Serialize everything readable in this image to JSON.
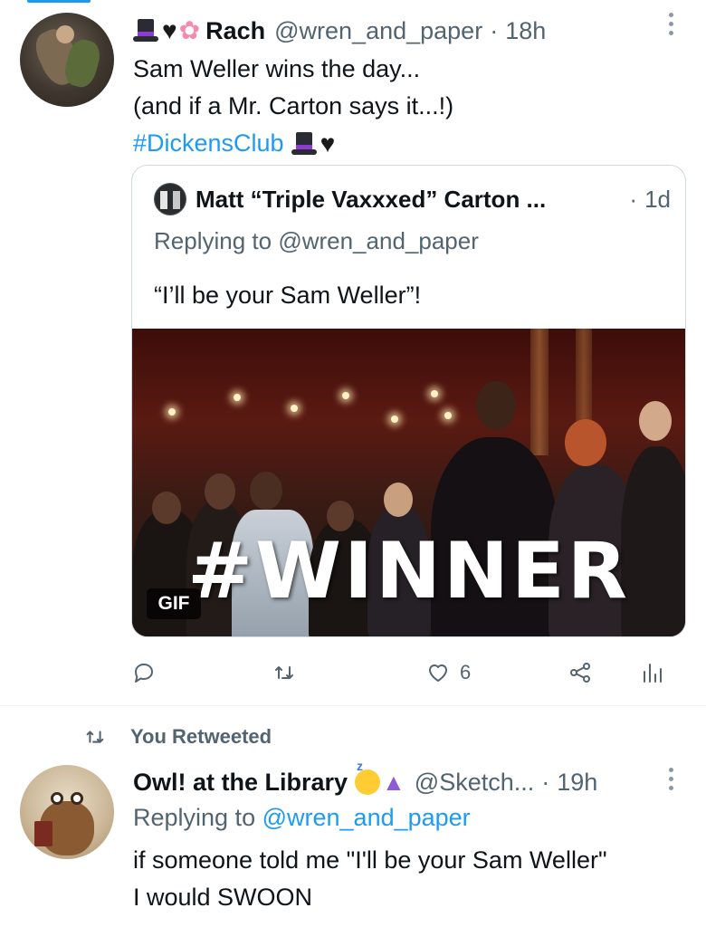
{
  "tweet1": {
    "author_name": "Rach",
    "handle": "@wren_and_paper",
    "separator": "·",
    "time": "18h",
    "name_emojis": [
      "top-hat-icon",
      "black-heart-icon",
      "cherry-blossom-icon"
    ],
    "text_lines": [
      "Sam Weller wins the day...",
      "(and if a Mr. Carton says it...!)"
    ],
    "hashtag": "#DickensClub",
    "quoted": {
      "author_name": "Matt “Triple Vaxxxed” Carton ...",
      "separator": "·",
      "time": "1d",
      "reply_prefix": "Replying to",
      "reply_handle": "@wren_and_paper",
      "text": "“I’ll be your Sam Weller”!",
      "gif_caption": "#WINNER",
      "gif_badge": "GIF"
    },
    "actions": {
      "reply_count": "",
      "retweet_count": "",
      "like_count": "6"
    }
  },
  "retweet_banner": "You Retweeted",
  "tweet2": {
    "author_name": "Owl! at the Library",
    "handle": "@Sketch...",
    "separator": "·",
    "time": "19h",
    "name_emojis": [
      "sleeping-face-icon",
      "mage-icon"
    ],
    "reply_prefix": "Replying to",
    "reply_handle": "@wren_and_paper",
    "text_lines": [
      "if someone told me \"I'll be your Sam Weller\"",
      "I would SWOON"
    ]
  },
  "colors": {
    "accent": "#1d9bf0",
    "muted": "#536471",
    "text": "#0f1419",
    "border": "#cfd9de"
  }
}
